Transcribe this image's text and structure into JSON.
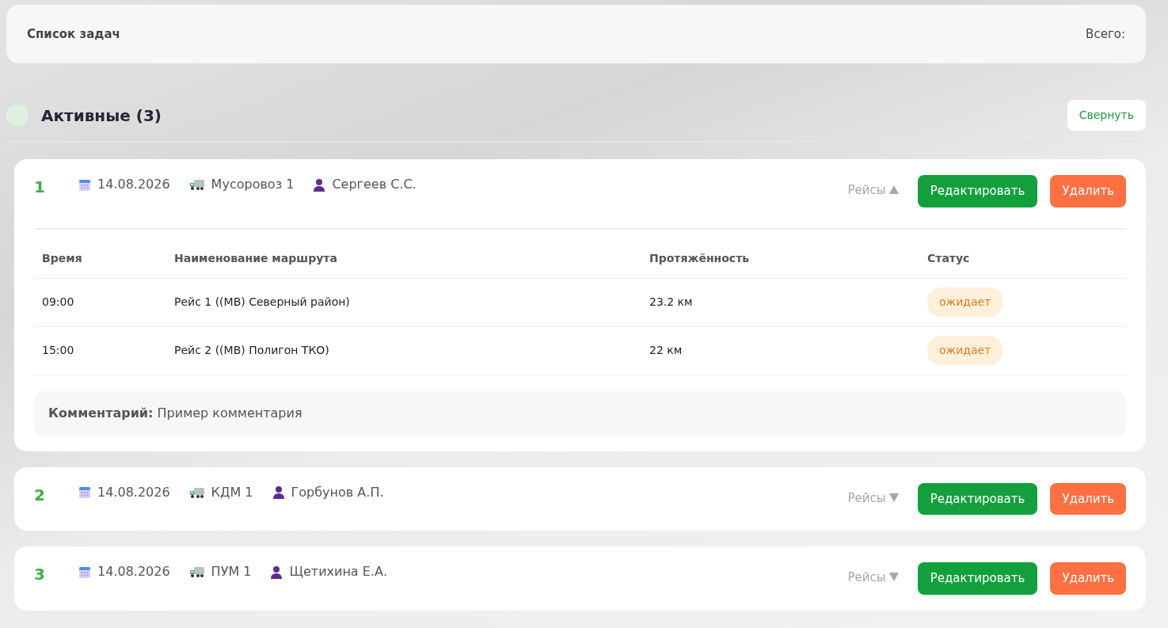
{
  "header": {
    "title": "Список задач",
    "total_label": "Всего:"
  },
  "section": {
    "title": "Активные (3)",
    "collapse_button": "Свернуть"
  },
  "columns": [
    "Время",
    "Наименование маршрута",
    "Протяжённость",
    "Статус"
  ],
  "tasks": [
    {
      "number": "1",
      "date": "14.08.2026",
      "vehicle": "Мусоровоз 1",
      "driver": "Сергеев С.С.",
      "trips_label": "Рейсы",
      "expanded": true,
      "edit": "Редактировать",
      "delete": "Удалить",
      "trips": [
        {
          "time": "09:00",
          "route": "Рейс 1 ((МВ) Северный район)",
          "length": "23.2 км",
          "status": "ожидает"
        },
        {
          "time": "15:00",
          "route": "Рейс 2 ((МВ) Полигон ТКО)",
          "length": "22 км",
          "status": "ожидает"
        }
      ],
      "comment_label": "Комментарий:",
      "comment": "Пример комментария"
    },
    {
      "number": "2",
      "date": "14.08.2026",
      "vehicle": "КДМ 1",
      "driver": "Горбунов А.П.",
      "trips_label": "Рейсы",
      "expanded": false,
      "edit": "Редактировать",
      "delete": "Удалить"
    },
    {
      "number": "3",
      "date": "14.08.2026",
      "vehicle": "ПУМ 1",
      "driver": "Щетихина Е.А.",
      "trips_label": "Рейсы",
      "expanded": false,
      "edit": "Редактировать",
      "delete": "Удалить"
    }
  ]
}
